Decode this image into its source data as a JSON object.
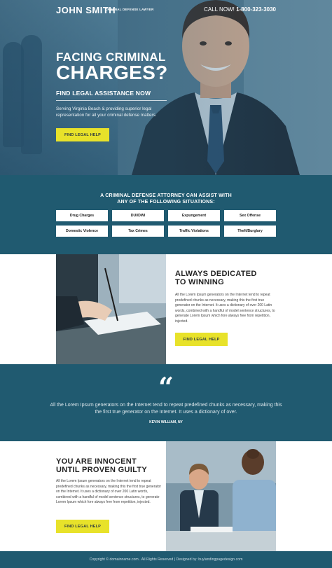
{
  "header": {
    "brand_name": "JOHN SMITH",
    "brand_tagline": "CRIMINAL DEFENSE LAWYER",
    "call_label": "CALL NOW!",
    "call_number": "1-800-323-3030"
  },
  "hero": {
    "headline_line1": "FACING CRIMINAL",
    "headline_line2": "CHARGES?",
    "subheadline": "FIND LEGAL ASSISTANCE NOW",
    "description": "Serving Virginia Beach & providing superior legal representation for all your criminal defense matters.",
    "cta_label": "FIND LEGAL HELP"
  },
  "situations": {
    "title_line1": "A CRIMINAL DEFENSE ATTORNEY CAN ASSIST WITH",
    "title_line2": "ANY OF THE FOLLOWING SITUATIONS:",
    "items": [
      {
        "label": "Drug Charges"
      },
      {
        "label": "DUI/DWI"
      },
      {
        "label": "Expungement"
      },
      {
        "label": "Sex Offense"
      },
      {
        "label": "Domestic Violence"
      },
      {
        "label": "Tax Crimes"
      },
      {
        "label": "Traffic Violations"
      },
      {
        "label": "Theft/Burglary"
      }
    ]
  },
  "dedicated": {
    "title_line1": "ALWAYS DEDICATED",
    "title_line2": "TO WINNING",
    "body": "All the Lorem Ipsum generators on the Internet tend to repeat predefined chunks as necessary, making this the first true generator on the Internet. It uses a dictionary of over 200 Latin words, combined with a handful of model sentence structures, to generate Lorem Ipsum which fore always free from repetition, injected.",
    "cta_label": "FIND LEGAL HELP"
  },
  "testimonial": {
    "quote_glyph": "“",
    "text": "All the Lorem Ipsum generators on the Internet tend to repeat predefined chunks as necessary, making this the first true generator on the Internet. It uses a dictionary of over.",
    "author": "KEVIN WILLIAM, NY"
  },
  "innocent": {
    "title_line1": "YOU ARE INNOCENT",
    "title_line2": "UNTIL PROVEN GUILTY",
    "body": "All the Lorem Ipsum generators on the Internet tend to repeat predefined chunks as necessary, making this the first true generator on the Internet. It uses a dictionary of over 200 Latin words, combined with a handful of model sentence structures, to generate Lorem Ipsum which fore always free from repetition, injected.",
    "cta_label": "FIND LEGAL HELP"
  },
  "footer": {
    "text": "Copyright © domainname.com . All Rights Reserved | Designed by: buylandingpagedesign.com"
  },
  "colors": {
    "accent_yellow": "#e8e22a",
    "primary_teal": "#205a70",
    "text_dark": "#222222"
  },
  "icons": {
    "quote": "quote-icon"
  }
}
